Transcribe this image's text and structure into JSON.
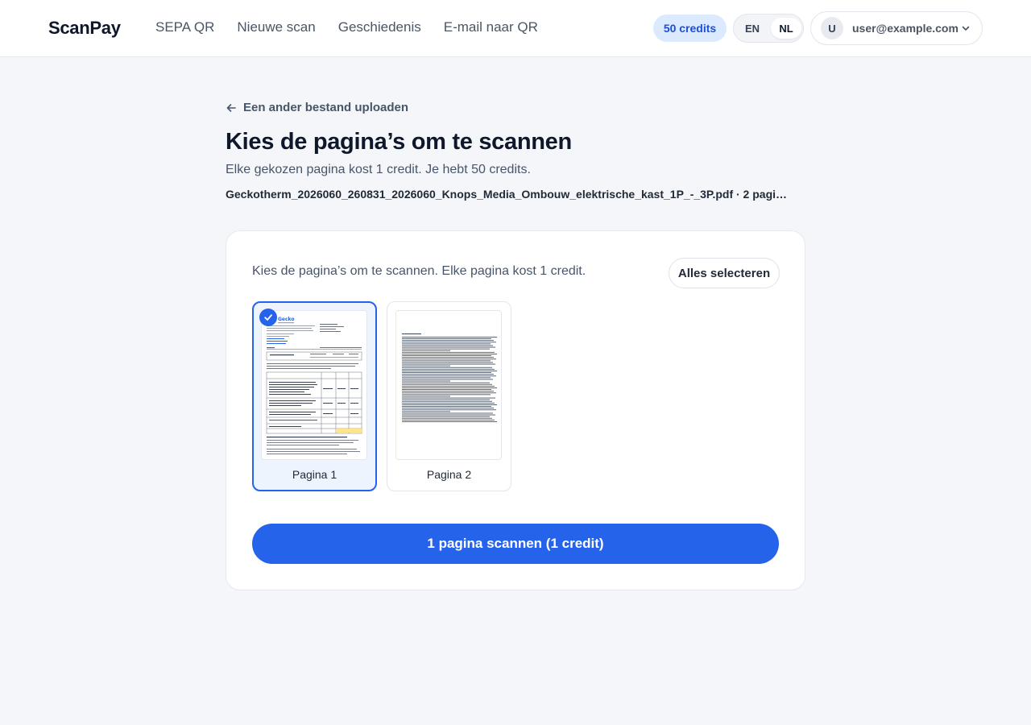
{
  "header": {
    "logo": "ScanPay",
    "nav": [
      "SEPA QR",
      "Nieuwe scan",
      "Geschiedenis",
      "E-mail naar QR"
    ],
    "credits": "50 credits",
    "languages": {
      "en": "EN",
      "nl": "NL",
      "active": "NL"
    },
    "user": {
      "initial": "U",
      "email": "user@example.com"
    }
  },
  "main": {
    "back_label": "Een ander bestand uploaden",
    "title": "Kies de pagina’s om te scannen",
    "subtitle": "Elke gekozen pagina kost 1 credit. Je hebt 50 credits.",
    "filename": "Geckotherm_2026060_260831_2026060_Knops_Media_Ombouw_elektrische_kast_1P_-_3P.pdf · 2 pagi…",
    "card": {
      "instructions": "Kies de pagina’s om te scannen. Elke pagina kost 1 credit.",
      "select_all": "Alles selecteren",
      "pages": [
        {
          "label": "Pagina 1",
          "selected": true
        },
        {
          "label": "Pagina 2",
          "selected": false
        }
      ],
      "scan_button": "1 pagina scannen (1 credit)"
    }
  },
  "colors": {
    "accent": "#2563eb",
    "background": "#f5f6fa",
    "credits_bg": "#dbeafe"
  }
}
